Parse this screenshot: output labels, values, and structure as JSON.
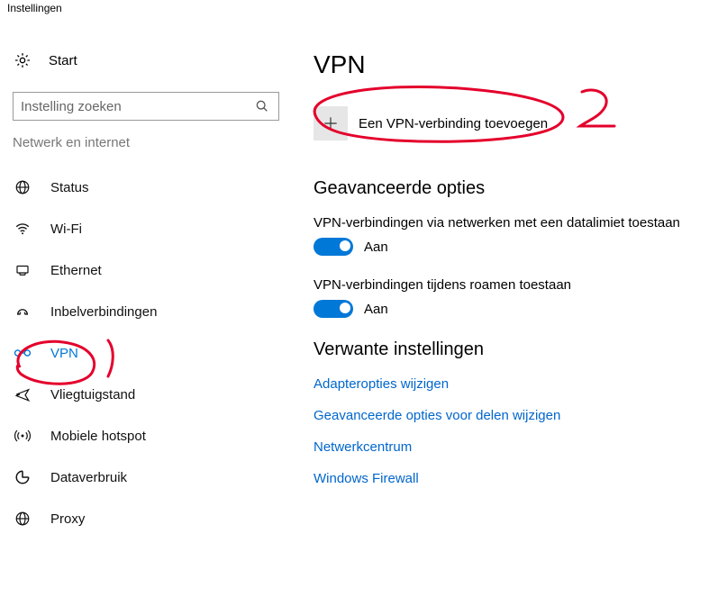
{
  "window": {
    "title": "Instellingen"
  },
  "sidebar": {
    "start_label": "Start",
    "search_placeholder": "Instelling zoeken",
    "category": "Netwerk en internet",
    "items": [
      {
        "label": "Status",
        "icon": "globe-icon"
      },
      {
        "label": "Wi-Fi",
        "icon": "wifi-icon"
      },
      {
        "label": "Ethernet",
        "icon": "ethernet-icon"
      },
      {
        "label": "Inbelverbindingen",
        "icon": "dialup-icon"
      },
      {
        "label": "VPN",
        "icon": "vpn-icon"
      },
      {
        "label": "Vliegtuigstand",
        "icon": "airplane-icon"
      },
      {
        "label": "Mobiele hotspot",
        "icon": "hotspot-icon"
      },
      {
        "label": "Dataverbruik",
        "icon": "datausage-icon"
      },
      {
        "label": "Proxy",
        "icon": "proxy-icon"
      }
    ],
    "selected_index": 4
  },
  "main": {
    "title": "VPN",
    "add_label": "Een VPN-verbinding toevoegen",
    "advanced": {
      "title": "Geavanceerde opties",
      "opt1": {
        "label": "VPN-verbindingen via netwerken met een datalimiet toestaan",
        "state": "Aan"
      },
      "opt2": {
        "label": "VPN-verbindingen tijdens roamen toestaan",
        "state": "Aan"
      }
    },
    "related": {
      "title": "Verwante instellingen",
      "links": [
        "Adapteropties wijzigen",
        "Geavanceerde opties voor delen wijzigen",
        "Netwerkcentrum",
        "Windows Firewall"
      ]
    }
  },
  "annotations": {
    "n1": "1",
    "n2": "2"
  }
}
